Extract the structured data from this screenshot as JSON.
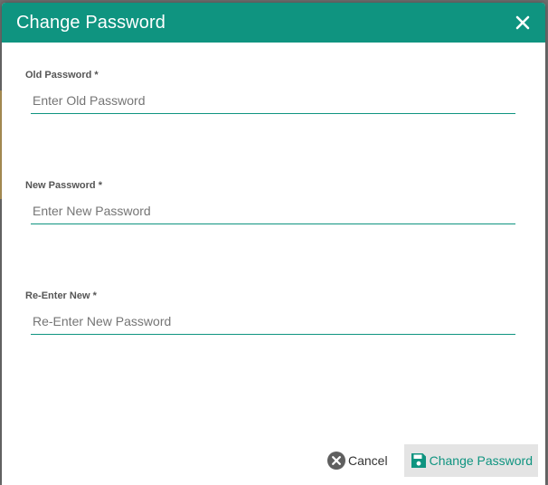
{
  "dialog": {
    "title": "Change Password",
    "close_icon": "close-icon"
  },
  "fields": [
    {
      "label": "Old Password *",
      "placeholder": "Enter Old Password",
      "value": ""
    },
    {
      "label": "New Password *",
      "placeholder": "Enter New Password",
      "value": ""
    },
    {
      "label": "Re-Enter New *",
      "placeholder": "Re-Enter New Password",
      "value": ""
    }
  ],
  "footer": {
    "cancel_label": "Cancel",
    "cancel_icon": "cancel-circle-icon",
    "submit_label": "Change Password",
    "submit_icon": "save-icon"
  },
  "colors": {
    "accent": "#0f9480",
    "header_text": "#ffffff",
    "button_bg": "#e4e4e4"
  }
}
